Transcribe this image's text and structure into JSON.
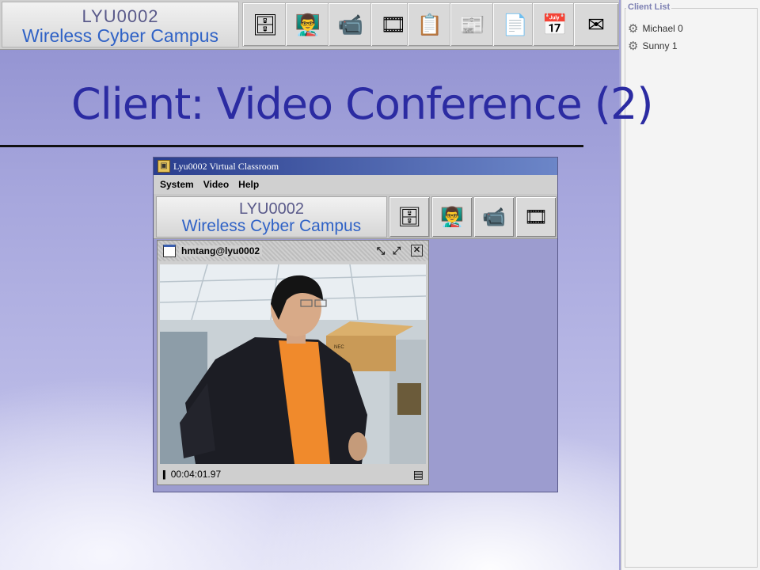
{
  "header": {
    "logo_line1": "LYU0002",
    "logo_line2": "Wireless Cyber Campus",
    "tools": [
      {
        "icon": "file-cabinet-icon",
        "glyph": "🗄"
      },
      {
        "icon": "teacher-icon",
        "glyph": "👨‍🏫"
      },
      {
        "icon": "video-camera-icon",
        "glyph": "📹"
      },
      {
        "icon": "film-icon",
        "glyph": "🎞"
      },
      {
        "icon": "clipboard-icon",
        "glyph": "📋"
      },
      {
        "icon": "news-icon",
        "glyph": "📰"
      },
      {
        "icon": "pdf-icon",
        "glyph": "📄"
      },
      {
        "icon": "calendar-icon",
        "glyph": "📅"
      },
      {
        "icon": "mail-icon",
        "glyph": "✉"
      }
    ]
  },
  "client_list": {
    "title": "Client List",
    "clients": [
      "Michael 0",
      "Sunny 1"
    ]
  },
  "slide": {
    "title": "Client: Video Conference (2)"
  },
  "app": {
    "window_title": "Lyu0002 Virtual Classroom",
    "menu": [
      "System",
      "Video",
      "Help"
    ],
    "logo_line1": "LYU0002",
    "logo_line2": "Wireless Cyber Campus",
    "tools": [
      {
        "icon": "file-cabinet-icon",
        "glyph": "🗄"
      },
      {
        "icon": "teacher-icon",
        "glyph": "👨‍🏫"
      },
      {
        "icon": "video-camera-icon",
        "glyph": "📹"
      },
      {
        "icon": "film-icon",
        "glyph": "🎞"
      }
    ],
    "video": {
      "user": "hmtang@lyu0002",
      "timestamp": "00:04:01.97",
      "box_text": "NEC"
    }
  },
  "colors": {
    "title": "#2b2ba2",
    "slide_bg": "#a7a7dd",
    "titlebar": "#2a3e8e"
  }
}
